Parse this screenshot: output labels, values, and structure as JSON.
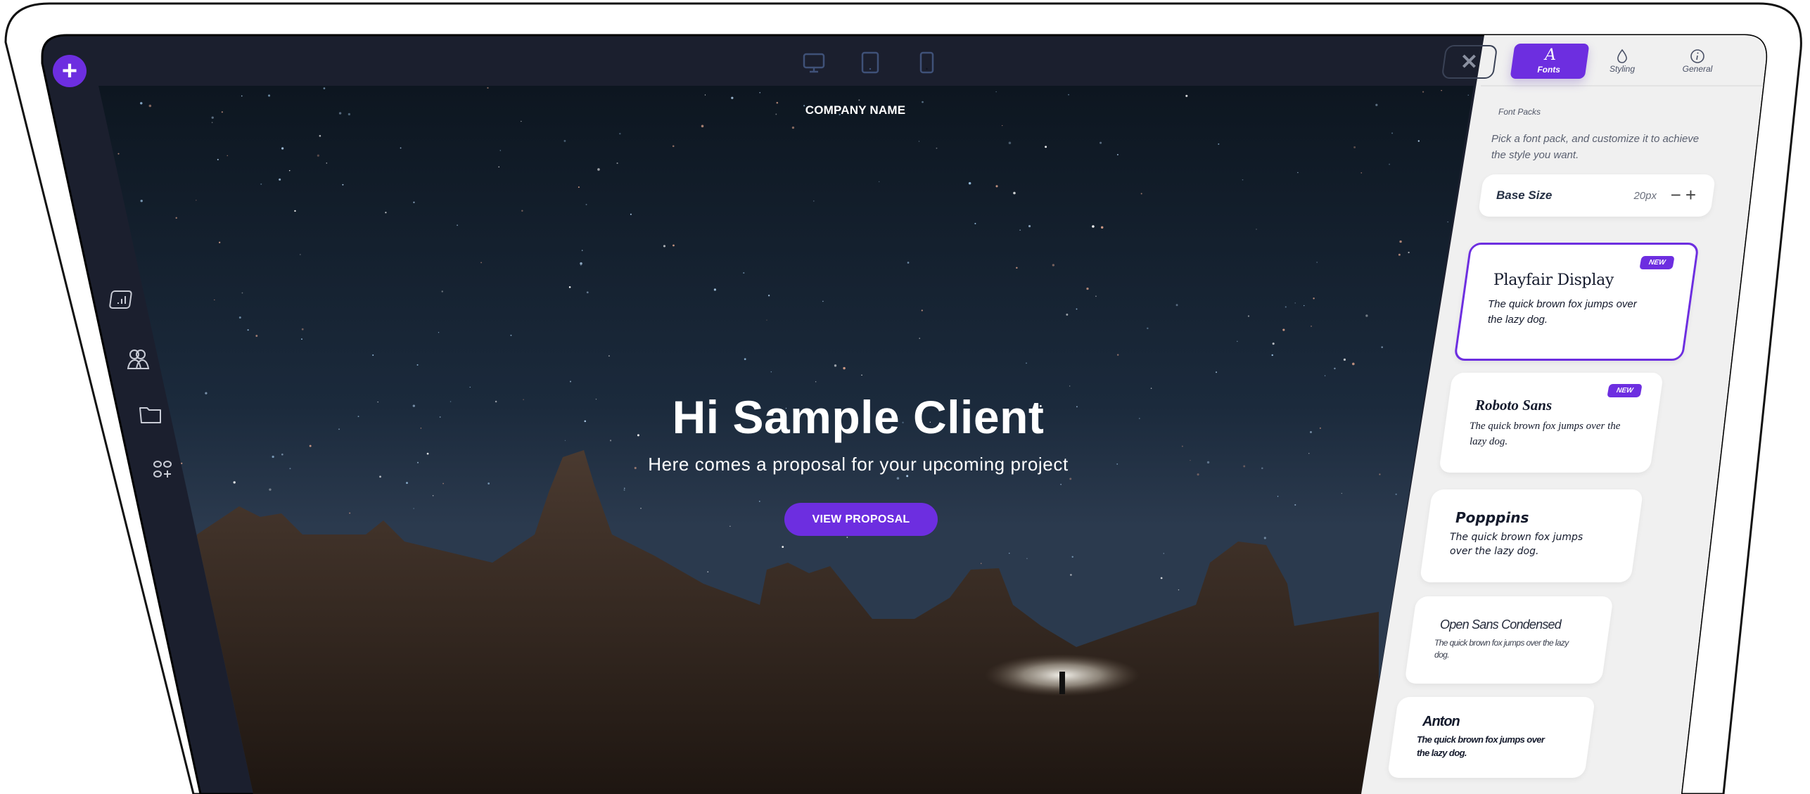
{
  "app": {
    "accent_color": "#6d2ee0",
    "chrome_color": "#1b1f2e"
  },
  "toolbar": {
    "add_button": "+",
    "device_views": [
      {
        "name": "desktop",
        "icon": "desktop-icon"
      },
      {
        "name": "tablet",
        "icon": "tablet-icon"
      },
      {
        "name": "mobile",
        "icon": "mobile-icon"
      }
    ],
    "close_label": "✕"
  },
  "sidebar": {
    "items": [
      {
        "name": "analytics",
        "icon": "chart-icon"
      },
      {
        "name": "contacts",
        "icon": "users-icon"
      },
      {
        "name": "files",
        "icon": "folder-icon"
      },
      {
        "name": "add-block",
        "icon": "grid-add-icon"
      }
    ]
  },
  "hero": {
    "company_name": "COMPANY NAME",
    "title": "Hi Sample Client",
    "subtitle": "Here comes a proposal for your upcoming project",
    "cta_label": "VIEW PROPOSAL"
  },
  "panel": {
    "tabs": [
      {
        "label": "Fonts",
        "glyph": "A",
        "active": true
      },
      {
        "label": "Styling",
        "glyph": "◇",
        "active": false
      },
      {
        "label": "General",
        "glyph": "ⓘ",
        "active": false
      }
    ],
    "section_heading": "Font Packs",
    "description": "Pick a font pack, and customize it to achieve the style you want.",
    "base_size": {
      "label": "Base Size",
      "value": "20px",
      "decrement": "−",
      "increment": "+"
    },
    "font_packs": [
      {
        "name": "Playfair Display",
        "sample": "The quick brown fox jumps over the lazy dog.",
        "badge": "NEW",
        "selected": true
      },
      {
        "name": "Roboto Sans",
        "sample": "The quick brown fox jumps over the lazy dog.",
        "badge": "NEW",
        "selected": false
      },
      {
        "name": "Popppins",
        "sample": "The quick brown fox jumps over the lazy dog.",
        "badge": null,
        "selected": false
      },
      {
        "name": "Open Sans Condensed",
        "sample": "The quick brown fox jumps over the lazy dog.",
        "badge": null,
        "selected": false
      },
      {
        "name": "Anton",
        "sample": "The quick brown fox jumps over the lazy dog.",
        "badge": null,
        "selected": false
      }
    ]
  }
}
